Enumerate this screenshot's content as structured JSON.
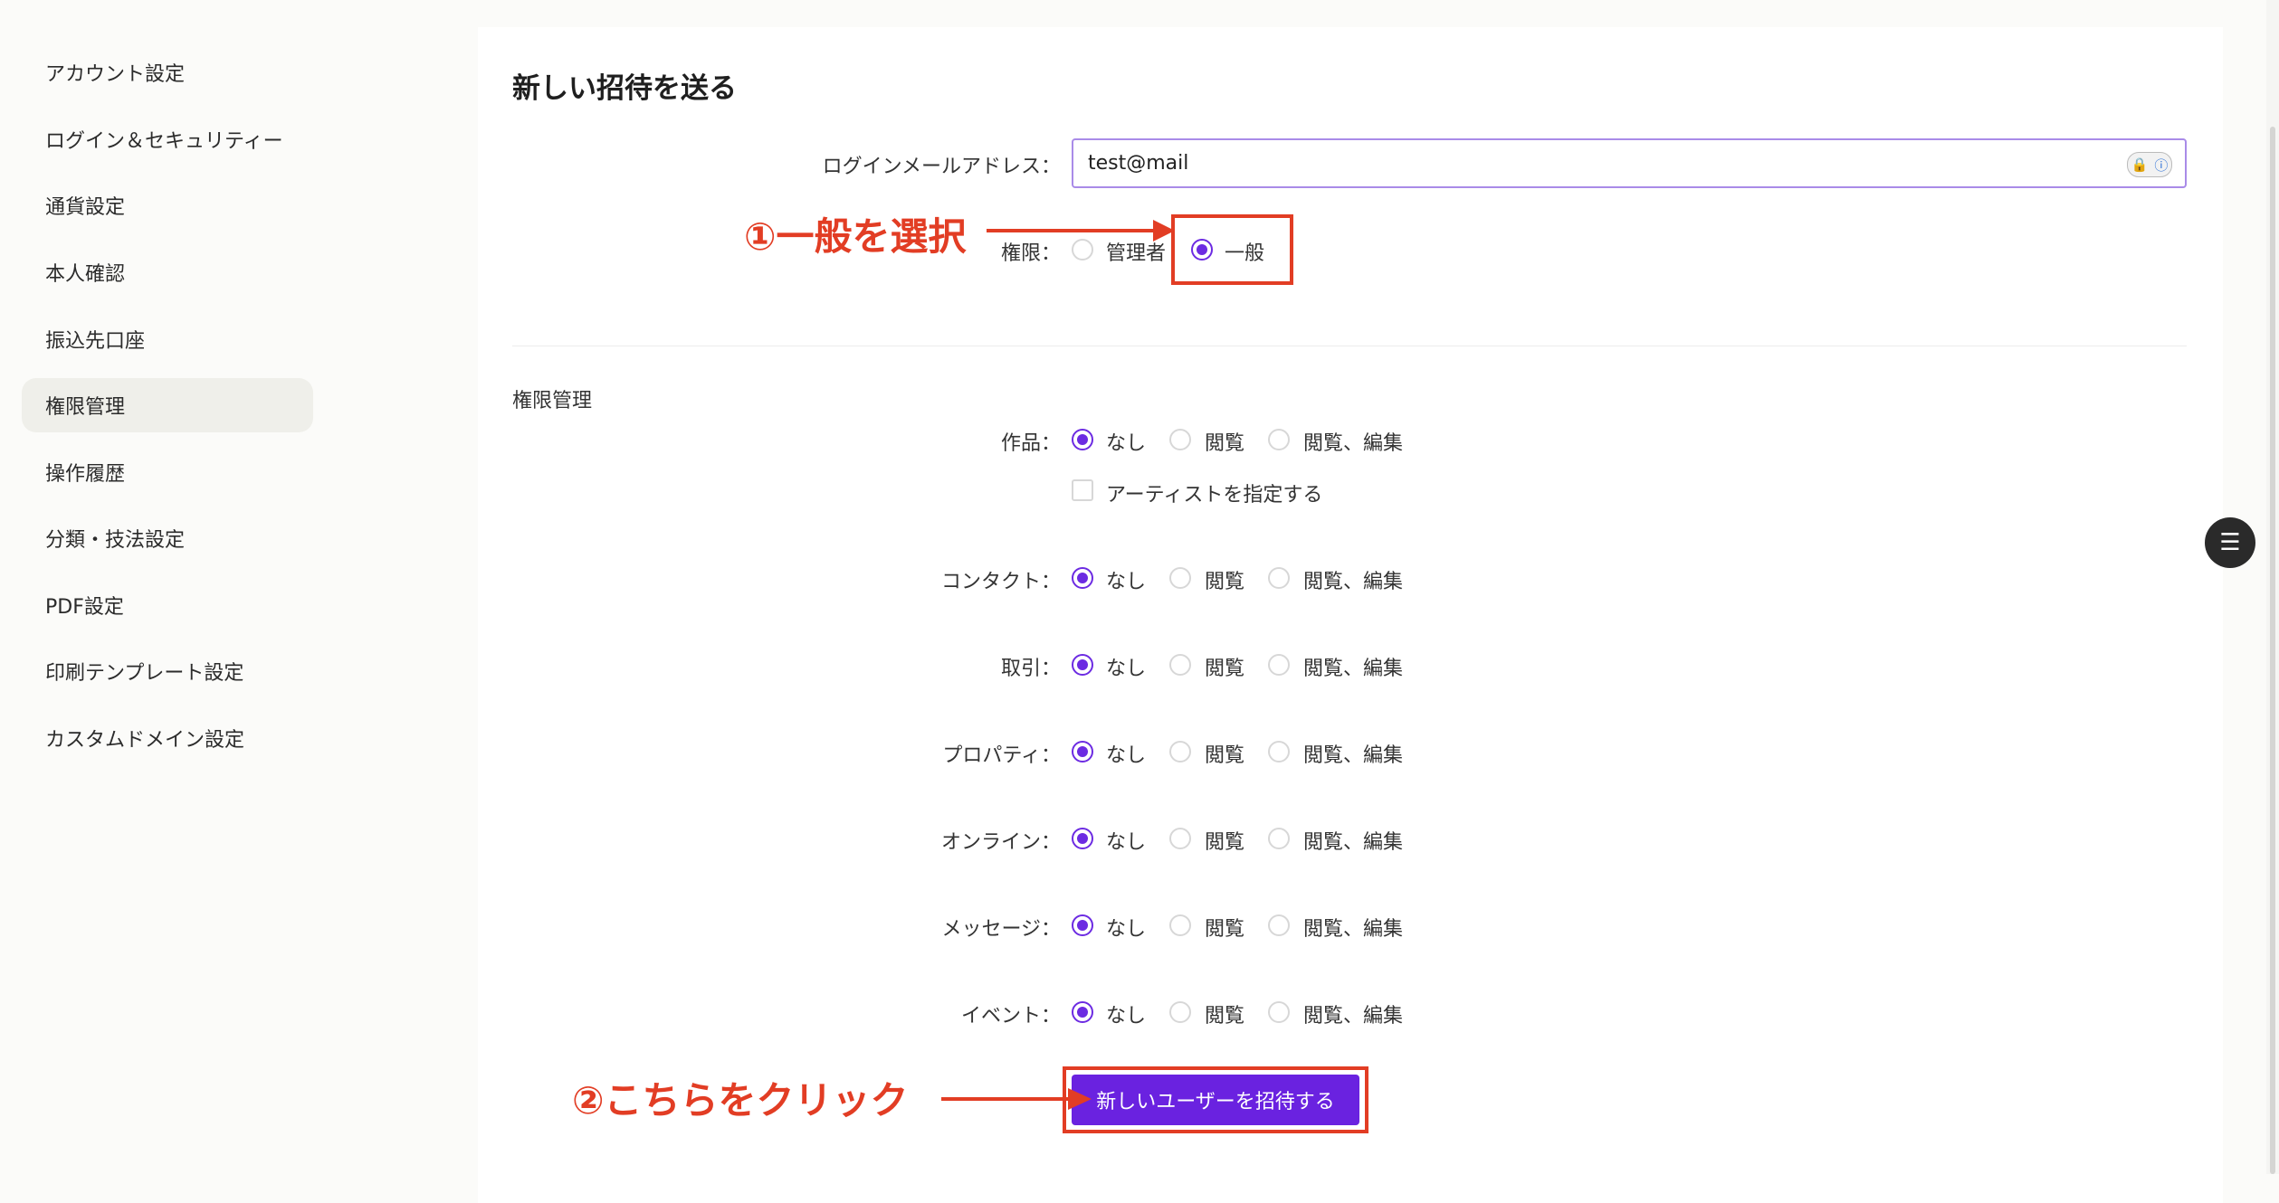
{
  "sidebar": {
    "items": [
      {
        "label": "アカウント設定",
        "active": false
      },
      {
        "label": "ログイン＆セキュリティー",
        "active": false
      },
      {
        "label": "通貨設定",
        "active": false
      },
      {
        "label": "本人確認",
        "active": false
      },
      {
        "label": "振込先口座",
        "active": false
      },
      {
        "label": "権限管理",
        "active": true
      },
      {
        "label": "操作履歴",
        "active": false
      },
      {
        "label": "分類・技法設定",
        "active": false
      },
      {
        "label": "PDF設定",
        "active": false
      },
      {
        "label": "印刷テンプレート設定",
        "active": false
      },
      {
        "label": "カスタムドメイン設定",
        "active": false
      }
    ]
  },
  "form": {
    "title": "新しい招待を送る",
    "email_label": "ログインメールアドレス：",
    "email_value": "test@mail",
    "role_label": "権限：",
    "role_admin": "管理者",
    "role_general": "一般",
    "role_selected": "一般",
    "section_title": "権限管理",
    "artist_checkbox_label": "アーティストを指定する",
    "option_none": "なし",
    "option_view": "閲覧",
    "option_edit": "閲覧、編集",
    "permissions": [
      {
        "label": "作品：",
        "selected": "なし"
      },
      {
        "label": "コンタクト：",
        "selected": "なし"
      },
      {
        "label": "取引：",
        "selected": "なし"
      },
      {
        "label": "プロパティ：",
        "selected": "なし"
      },
      {
        "label": "オンライン：",
        "selected": "なし"
      },
      {
        "label": "メッセージ：",
        "selected": "なし"
      },
      {
        "label": "イベント：",
        "selected": "なし"
      }
    ],
    "submit_label": "新しいユーザーを招待する"
  },
  "annotations": {
    "step1": "①一般を選択",
    "step2": "②こちらをクリック",
    "color": "#e23d24"
  },
  "colors": {
    "accent": "#6a22e0",
    "annotation": "#e23d24"
  }
}
